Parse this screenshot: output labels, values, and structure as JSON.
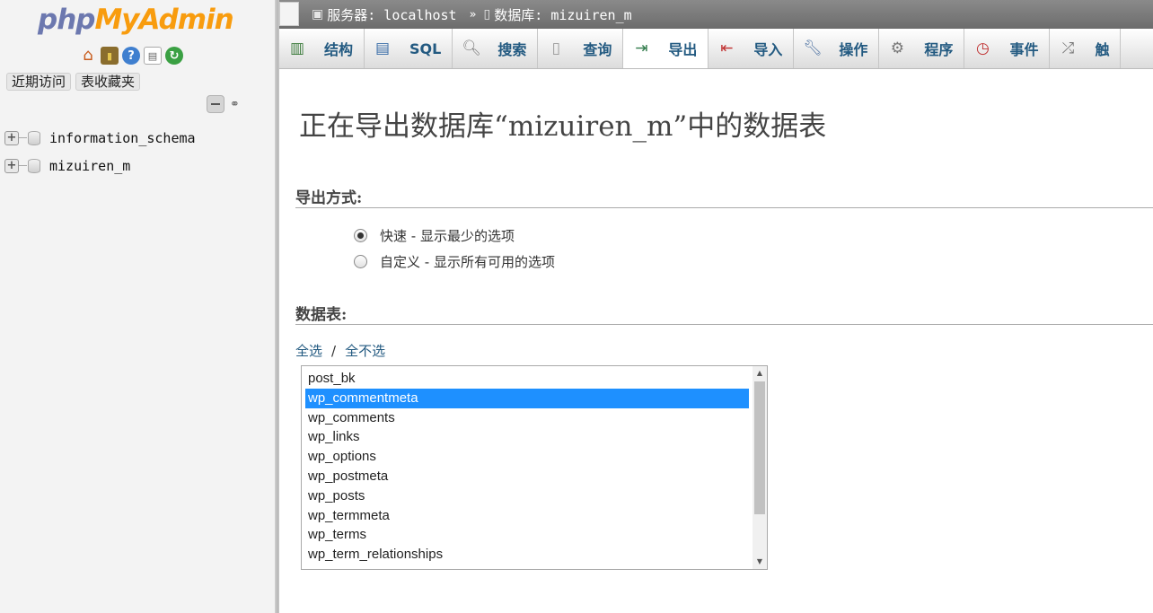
{
  "nav": {
    "logo": {
      "php": "php",
      "my": "My",
      "admin": "Admin"
    },
    "icons": [
      "home-icon",
      "exit-icon",
      "help-icon",
      "docs-icon",
      "reload-icon"
    ],
    "tabs": [
      "近期访问",
      "表收藏夹"
    ],
    "databases": [
      "information_schema",
      "mizuiren_m"
    ]
  },
  "breadcrumb": {
    "server_label": "服务器: localhost",
    "separator": "»",
    "database_label": "数据库: mizuiren_m"
  },
  "menu": {
    "tabs": [
      {
        "label": "结构",
        "icon": "structure-icon"
      },
      {
        "label": "SQL",
        "icon": "sql-icon"
      },
      {
        "label": "搜索",
        "icon": "search-icon"
      },
      {
        "label": "查询",
        "icon": "query-icon"
      },
      {
        "label": "导出",
        "icon": "export-icon",
        "active": true
      },
      {
        "label": "导入",
        "icon": "import-icon"
      },
      {
        "label": "操作",
        "icon": "wrench-icon"
      },
      {
        "label": "程序",
        "icon": "routines-icon"
      },
      {
        "label": "事件",
        "icon": "events-icon"
      },
      {
        "label": "触",
        "icon": "triggers-icon"
      }
    ]
  },
  "main": {
    "title": "正在导出数据库“mizuiren_m”中的数据表",
    "export_method_heading": "导出方式:",
    "quick_option": "快速 - 显示最少的选项",
    "custom_option": "自定义 - 显示所有可用的选项",
    "quick_selected": true,
    "tables_heading": "数据表:",
    "select_all": "全选",
    "slash": "/",
    "select_none": "全不选",
    "tables": [
      "post_bk",
      "wp_commentmeta",
      "wp_comments",
      "wp_links",
      "wp_options",
      "wp_postmeta",
      "wp_posts",
      "wp_termmeta",
      "wp_terms",
      "wp_term_relationships"
    ],
    "selected_table": "wp_commentmeta"
  },
  "colors": {
    "link": "#235a81",
    "selection": "#1e90ff",
    "nav_bg": "#f3f3f3"
  }
}
